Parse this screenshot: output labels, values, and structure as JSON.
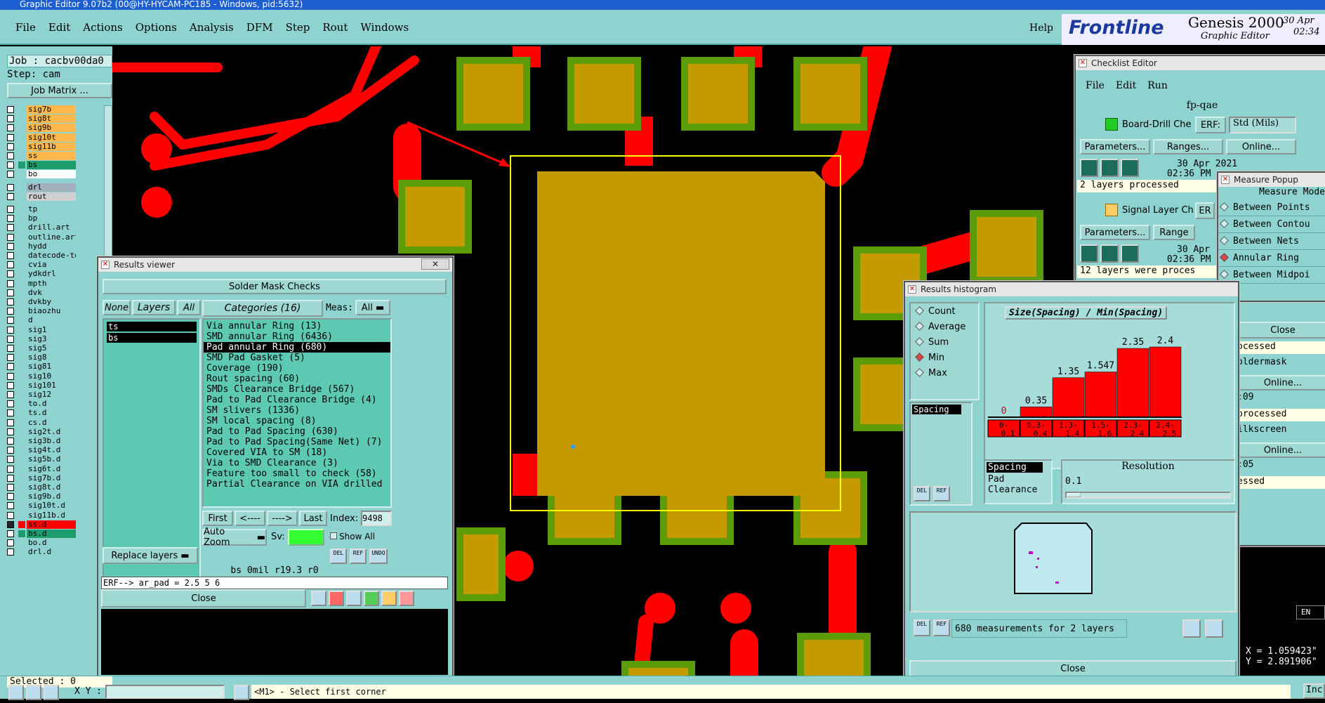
{
  "window_title": "Graphic Editor 9.07b2 (00@HY-HYCAM-PC185 - Windows, pid:5632)",
  "menu": [
    "File",
    "Edit",
    "Actions",
    "Options",
    "Analysis",
    "DFM",
    "Step",
    "Rout",
    "Windows"
  ],
  "help": "Help",
  "brand": {
    "logo": "Frontline",
    "product": "Genesis 2000",
    "sub": "Graphic Editor",
    "date": "30 Apr",
    "time": "02:34"
  },
  "job_label": "Job : cacbv00da0",
  "step_label": "Step: cam",
  "job_matrix": "Job Matrix ...",
  "selected": "Selected : 0",
  "coord_label": "X Y :",
  "status_hint": "<M1> - Select first corner",
  "layers": [
    {
      "name": "sig7b",
      "color": "#ffb84d"
    },
    {
      "name": "sig8t",
      "color": "#ffb84d"
    },
    {
      "name": "sig9b",
      "color": "#ffb84d"
    },
    {
      "name": "sig10t",
      "color": "#ffb84d"
    },
    {
      "name": "sig11b",
      "color": "#ffb84d"
    },
    {
      "name": "ss",
      "color": "#ffb84d"
    },
    {
      "name": "bs",
      "color": "#1c9c6c"
    },
    {
      "name": "bo",
      "color": "#ffffff"
    },
    {
      "name": "drl",
      "color": "#a0b0bc"
    },
    {
      "name": "rout",
      "color": "#d0d0d0"
    },
    {
      "name": "tp",
      "color": ""
    },
    {
      "name": "bp",
      "color": ""
    },
    {
      "name": "drill.art",
      "color": ""
    },
    {
      "name": "outline.art",
      "color": ""
    },
    {
      "name": "hydd",
      "color": ""
    },
    {
      "name": "datecode-to",
      "color": ""
    },
    {
      "name": "cvia",
      "color": ""
    },
    {
      "name": "ydkdrl",
      "color": ""
    },
    {
      "name": "mpth",
      "color": ""
    },
    {
      "name": "dvk",
      "color": ""
    },
    {
      "name": "dvkby",
      "color": ""
    },
    {
      "name": "biaozhu",
      "color": ""
    },
    {
      "name": "d",
      "color": ""
    },
    {
      "name": "sig1",
      "color": ""
    },
    {
      "name": "sig3",
      "color": ""
    },
    {
      "name": "sig5",
      "color": ""
    },
    {
      "name": "sig8",
      "color": ""
    },
    {
      "name": "sig81",
      "color": ""
    },
    {
      "name": "sig10",
      "color": ""
    },
    {
      "name": "sig101",
      "color": ""
    },
    {
      "name": "sig12",
      "color": ""
    },
    {
      "name": "to.d",
      "color": ""
    },
    {
      "name": "ts.d",
      "color": ""
    },
    {
      "name": "cs.d",
      "color": ""
    },
    {
      "name": "sig2t.d",
      "color": ""
    },
    {
      "name": "sig3b.d",
      "color": ""
    },
    {
      "name": "sig4t.d",
      "color": ""
    },
    {
      "name": "sig5b.d",
      "color": ""
    },
    {
      "name": "sig6t.d",
      "color": ""
    },
    {
      "name": "sig7b.d",
      "color": ""
    },
    {
      "name": "sig8t.d",
      "color": ""
    },
    {
      "name": "sig9b.d",
      "color": ""
    },
    {
      "name": "sig10t.d",
      "color": ""
    },
    {
      "name": "sig11b.d",
      "color": ""
    },
    {
      "name": "ss.d",
      "color": "#f00"
    },
    {
      "name": "bs.d",
      "color": "#1c9c6c"
    },
    {
      "name": "bo.d",
      "color": ""
    },
    {
      "name": "drl.d",
      "color": ""
    }
  ],
  "results_viewer": {
    "title": "Results viewer",
    "header": "Solder Mask Checks",
    "none": "None",
    "layers_btn": "Layers",
    "all": "All",
    "layer_items": [
      "ts",
      "bs"
    ],
    "categories_btn": "Categories (16)",
    "meas_label": "Meas:",
    "meas_value": "All",
    "categories": [
      "Via annular Ring (13)",
      "SMD annular Ring (6436)",
      "Pad annular Ring (680)",
      "SMD Pad Gasket (5)",
      "Coverage (190)",
      "Rout spacing (60)",
      "SMDs Clearance Bridge (567)",
      "Pad to Pad Clearance Bridge (4)",
      "SM slivers (1336)",
      "SM local spacing (8)",
      "Pad to Pad Spacing (630)",
      "Pad to Pad Spacing(Same Net) (7)",
      "Covered VIA to SM (18)",
      "Via to SMD Clearance (3)",
      "Feature too small to check (58)",
      "Partial Clearance on VIA drilled"
    ],
    "selected_index": 2,
    "first": "First",
    "prev": "<----",
    "next": "---->",
    "last": "Last",
    "index_label": "Index:",
    "index_value": "9498",
    "auto_zoom": "Auto Zoom",
    "sv": "Sv:",
    "show_all": "Show All",
    "replace_layers": "Replace layers",
    "info": "bs 0mil  r19.3  r0",
    "erf": "ERF--> ar_pad = 2.5 5 6",
    "close": "Close"
  },
  "histogram": {
    "title": "Results histogram",
    "modes": [
      "Count",
      "Average",
      "Sum",
      "Min",
      "Max"
    ],
    "selected_mode": "Min",
    "measures": [
      "Spacing"
    ],
    "chart_title": "Size(Spacing) / Min(Spacing)",
    "chart_data": {
      "type": "bar",
      "title": "Size(Spacing) / Min(Spacing)",
      "categories": [
        "0-0.1",
        "0.3-0.4",
        "1.3-1.4",
        "1.5-1.6",
        "2.3-2.4",
        "2.4-2.5"
      ],
      "values": [
        0,
        0.35,
        1.35,
        1.547,
        2.35,
        2.4
      ],
      "value_labels": [
        "0",
        "0.35",
        "1.35",
        "1.547",
        "2.35",
        "2.4"
      ],
      "bar_color": "#ff0000",
      "ylim": [
        0,
        2.4
      ]
    },
    "sort_items": [
      "Spacing",
      "Pad",
      "Clearance"
    ],
    "resolution_label": "Resolution",
    "resolution_value": "0.1",
    "del": "DEL",
    "ref": "REF",
    "summary": "680 measurements for 2 layers",
    "close": "Close"
  },
  "checklist": {
    "title": "Checklist Editor",
    "menu": [
      "File",
      "Edit",
      "Run"
    ],
    "name": "fp-qae",
    "item1": "Board-Drill Che",
    "erf": "ERF:",
    "std": "Std (Mils)",
    "params": "Parameters...",
    "ranges": "Ranges...",
    "online": "Online...",
    "date1": "30 Apr 2021",
    "time1": "02:36 PM",
    "msg1": "2 layers processed",
    "item2": "Signal Layer Ch",
    "erf2": "ER",
    "ranges2": "Range",
    "date2": "30 Apr",
    "time2": "02:36 PM",
    "msg2": "12 layers were proces",
    "right_msgs": [
      "ocessed",
      "oldermask",
      "Online...",
      ":09",
      "processed",
      "ilkscreen",
      "Online...",
      ":05",
      "essed"
    ],
    "close": "Close"
  },
  "measure_popup": {
    "title": "Measure Popup",
    "header": "Measure Mode",
    "modes": [
      "Between Points",
      "Between Contou",
      "Between Nets",
      "Annular Ring",
      "Between Midpoi"
    ],
    "selected": "Annular Ring"
  },
  "coords": {
    "x": "X = 1.059423\"",
    "y": "Y = 2.891906\""
  },
  "lang": "EN",
  "inch": "Inc"
}
